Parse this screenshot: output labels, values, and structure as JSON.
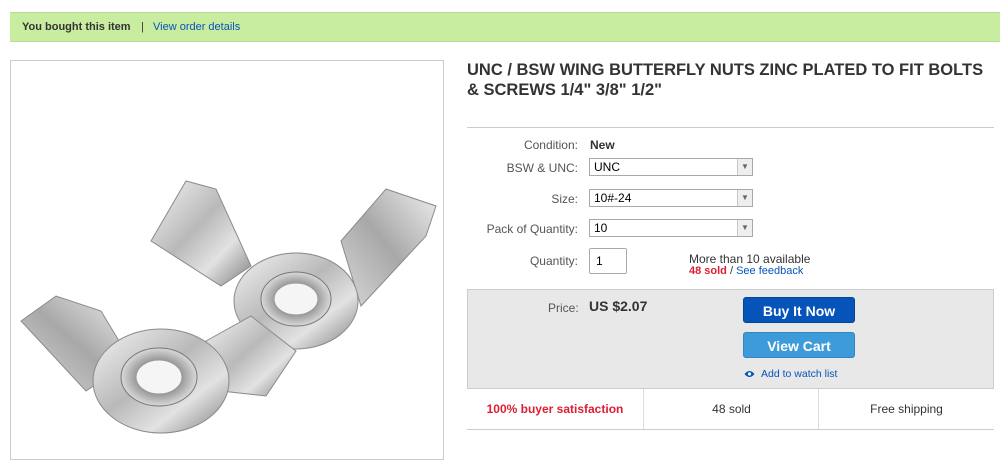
{
  "banner": {
    "bought_text": "You bought this item",
    "separator": "|",
    "order_link": "View order details"
  },
  "product": {
    "title": "UNC / BSW WING BUTTERFLY NUTS ZINC PLATED TO FIT BOLTS & SCREWS 1/4\" 3/8\" 1/2\""
  },
  "details": {
    "condition_label": "Condition:",
    "condition_value": "New",
    "bsw_label": "BSW & UNC:",
    "bsw_value": "UNC",
    "size_label": "Size:",
    "size_value": "10#-24",
    "pack_label": "Pack of Quantity:",
    "pack_value": "10",
    "quantity_label": "Quantity:",
    "quantity_value": "1",
    "availability": "More than 10 available",
    "sold_count": "48 sold",
    "sold_separator": " / ",
    "feedback_link": "See feedback"
  },
  "pricing": {
    "price_label": "Price:",
    "price_value": "US $2.07",
    "buy_button": "Buy It Now",
    "cart_button": "View Cart",
    "watch_link": "Add to watch list"
  },
  "stats": {
    "satisfaction": "100% buyer satisfaction",
    "sold": "48 sold",
    "shipping": "Free shipping"
  },
  "icons": {
    "select_arrow": "chevron-down-icon",
    "watch": "eye-icon"
  },
  "colors": {
    "banner_bg": "#c8eca0",
    "link": "#0654ba",
    "buy_button": "#0654ba",
    "cart_button": "#3d9bd9",
    "alert_red": "#dd1e31",
    "panel_bg": "#e8e8e8"
  }
}
